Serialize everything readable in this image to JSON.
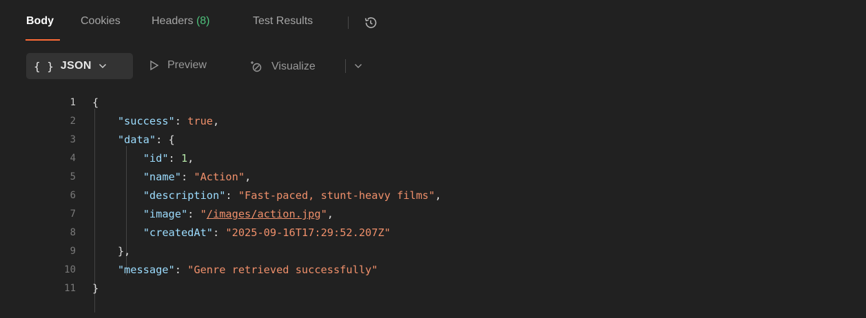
{
  "tabs": {
    "body": "Body",
    "cookies": "Cookies",
    "headers": "Headers",
    "headers_count": "(8)",
    "test_results": "Test Results"
  },
  "toolbar": {
    "format_braces": "{ }",
    "format_label": "JSON",
    "preview_label": "Preview",
    "visualize_label": "Visualize"
  },
  "editor": {
    "line_numbers": [
      "1",
      "2",
      "3",
      "4",
      "5",
      "6",
      "7",
      "8",
      "9",
      "10",
      "11"
    ],
    "keys": {
      "success": "\"success\"",
      "data": "\"data\"",
      "id": "\"id\"",
      "name": "\"name\"",
      "description": "\"description\"",
      "image": "\"image\"",
      "createdAt": "\"createdAt\"",
      "message": "\"message\""
    },
    "values": {
      "success": "true",
      "id": "1",
      "name": "\"Action\"",
      "description": "\"Fast-paced, stunt-heavy films\"",
      "image_quote_open": "\"",
      "image_path": "/images/action.jpg",
      "image_quote_close": "\"",
      "createdAt": "\"2025-09-16T17:29:52.207Z\"",
      "message": "\"Genre retrieved successfully\""
    }
  }
}
